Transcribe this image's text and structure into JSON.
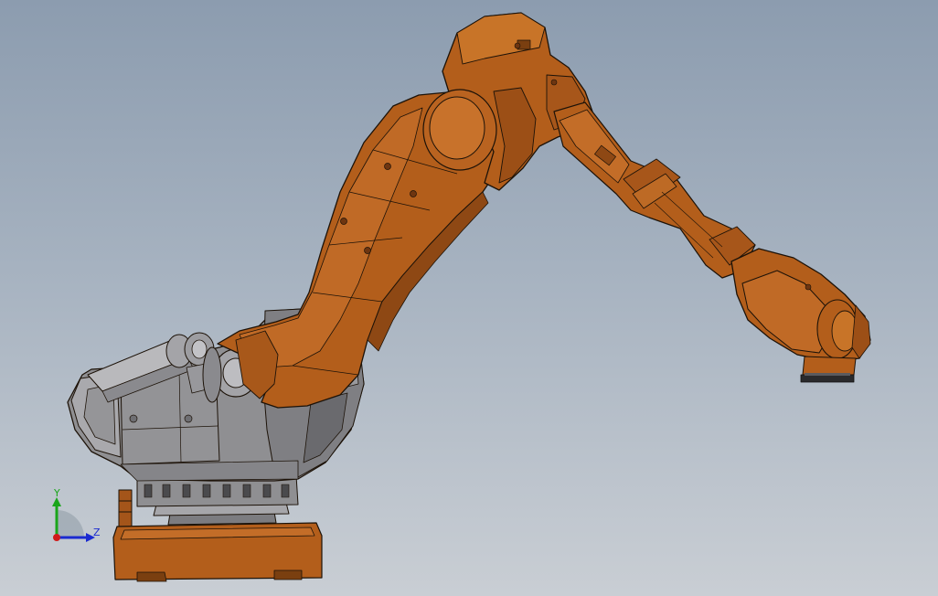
{
  "window": {
    "view": "cad-3d-viewport"
  },
  "triad": {
    "y_label": "Y",
    "z_label": "Z",
    "y_color": "#1aa51a",
    "z_color": "#1a2ad0",
    "x_color": "#d01a1a"
  },
  "colors": {
    "arm": "#b35e1b",
    "arm_shadow": "#7a3f10",
    "arm_highlight": "#d27f33",
    "base_gray": "#8f8f92",
    "base_dark": "#5d5d60",
    "base_light": "#b9b9bc",
    "edge": "#1c1208"
  },
  "model": {
    "parts": [
      "pedestal",
      "turntable",
      "base-housing",
      "counterbalance-cylinder",
      "shoulder-joint",
      "lower-arm",
      "elbow-housing",
      "upper-arm",
      "wrist",
      "tool-flange"
    ]
  }
}
